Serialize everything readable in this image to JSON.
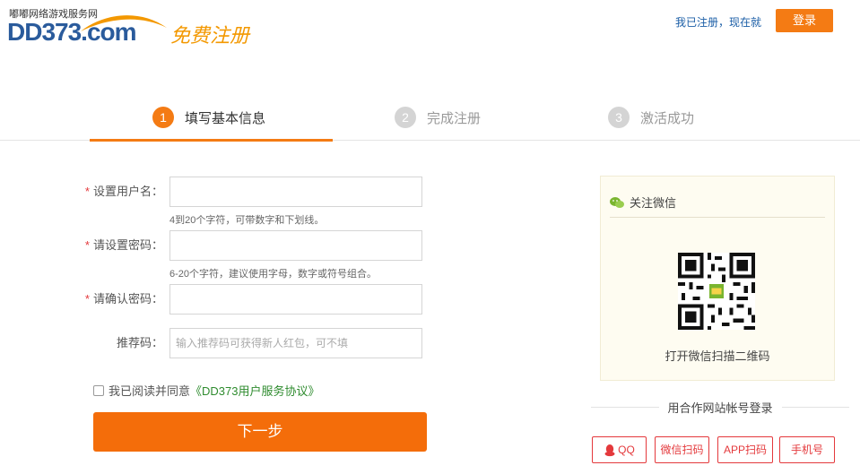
{
  "header": {
    "logo_slogan": "嘟嘟网络游戏服务网",
    "logo_brand": "DD373.com",
    "page_heading": "免费注册",
    "login_tip": "我已注册，现在就",
    "login_button": "登录",
    "accent_color": "#f47b14"
  },
  "steps": [
    {
      "num": "1",
      "label": "填写基本信息",
      "state": "active"
    },
    {
      "num": "2",
      "label": "完成注册",
      "state": "inactive"
    },
    {
      "num": "3",
      "label": "激活成功",
      "state": "inactive"
    }
  ],
  "form": {
    "username": {
      "label": "设置用户名：",
      "required": "*",
      "value": "",
      "hint": "4到20个字符，可带数字和下划线。"
    },
    "password": {
      "label": "请设置密码：",
      "required": "*",
      "value": "",
      "hint": "6-20个字符，建议使用字母，数字或符号组合。"
    },
    "confirm": {
      "label": "请确认密码：",
      "required": "*",
      "value": ""
    },
    "referral": {
      "label": "推荐码：",
      "value": "",
      "placeholder": "输入推荐码可获得新人红包，可不填"
    },
    "agreement": {
      "text": "我已阅读并同意",
      "link": "《DD373用户服务协议》",
      "checked": false
    },
    "next_button": "下一步"
  },
  "wechat": {
    "title": "关注微信",
    "icon": "wechat-icon",
    "caption": "打开微信扫描二维码"
  },
  "partner_login": {
    "title": "用合作网站帐号登录",
    "buttons": [
      {
        "label": "QQ",
        "icon": "qq-icon"
      },
      {
        "label": "微信扫码"
      },
      {
        "label": "APP扫码"
      },
      {
        "label": "手机号"
      }
    ]
  }
}
